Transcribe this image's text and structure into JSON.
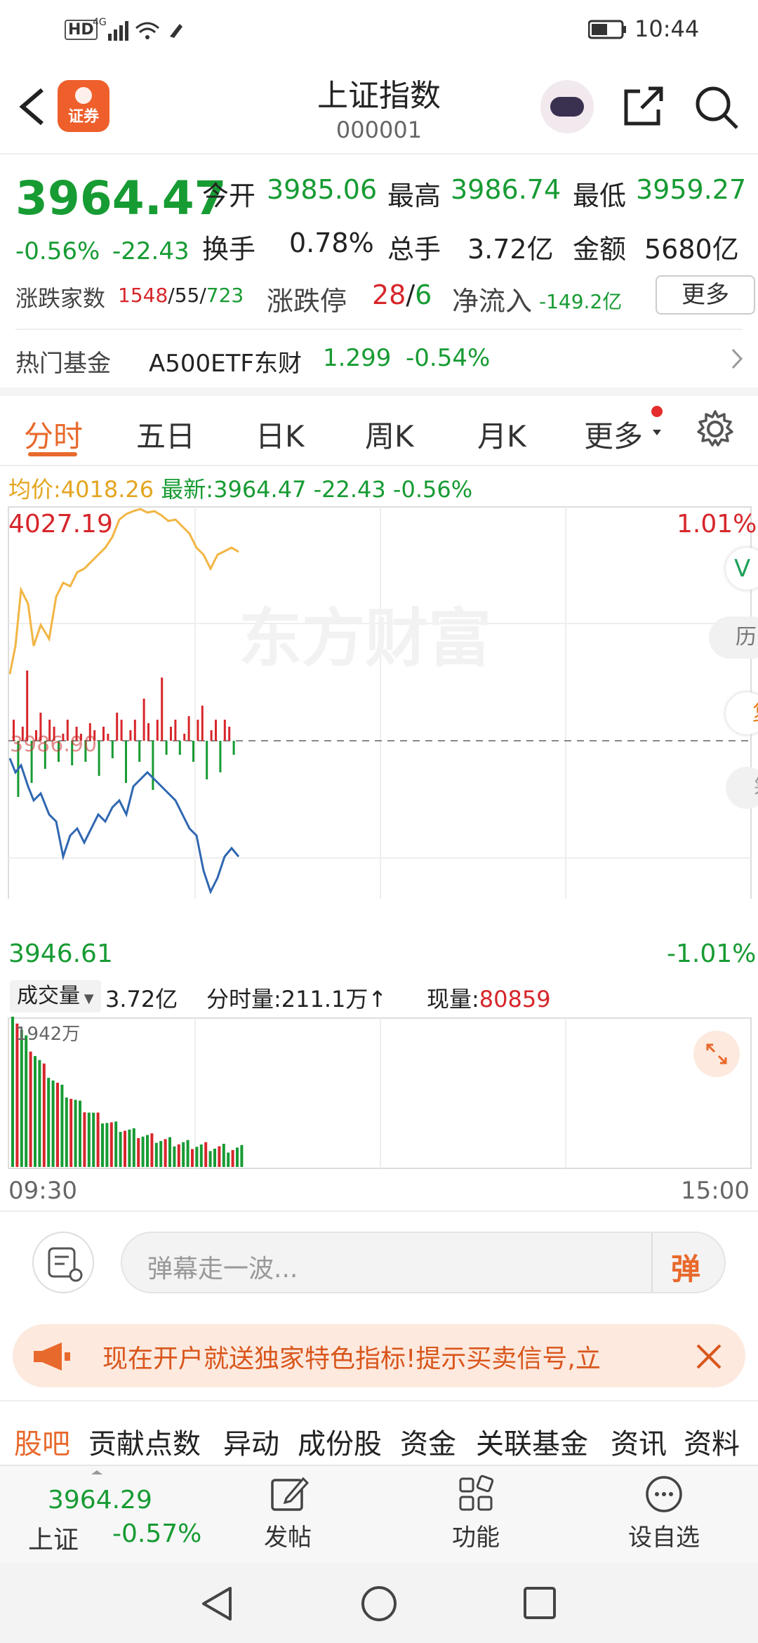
{
  "status": {
    "indicators": "HD 4G",
    "time": "10:44"
  },
  "header": {
    "app_badge": "证券",
    "title": "上证指数",
    "code": "000001"
  },
  "quote": {
    "price": "3964.47",
    "change_pct": "-0.56%",
    "change": "-22.43",
    "open_label": "今开",
    "open": "3985.06",
    "high_label": "最高",
    "high": "3986.74",
    "low_label": "最低",
    "low": "3959.27",
    "turnover_label": "换手",
    "turnover": "0.78%",
    "volume_label": "总手",
    "volume": "3.72亿",
    "amount_label": "金额",
    "amount": "5680亿",
    "breadth_label": "涨跌家数",
    "up": "1548",
    "flat": "55",
    "down": "723",
    "limit_label": "涨跌停",
    "limit_up": "28",
    "limit_down": "6",
    "netflow_label": "净流入",
    "netflow": "-149.2亿",
    "more": "更多"
  },
  "fund": {
    "label": "热门基金",
    "name": "A500ETF东财",
    "price": "1.299",
    "change": "-0.54%"
  },
  "tabs": [
    "分时",
    "五日",
    "日K",
    "周K",
    "月K",
    "更多"
  ],
  "chart": {
    "avg_label": "均价:",
    "avg": "4018.26",
    "last_label": "最新:",
    "last": "3964.47",
    "last_chg": "-22.43",
    "last_pct": "-0.56%",
    "y_top": "4027.19",
    "y_bottom": "3946.61",
    "pct_top": "1.01%",
    "pct_bottom": "-1.01%",
    "prev_close": "3986.90",
    "watermark": "东方财富",
    "side_buttons": [
      "V",
      "历",
      "复",
      "筹"
    ],
    "volume_selector": "成交量",
    "total_volume": "3.72亿",
    "minute_volume": "分时量:211.1万↑",
    "now_label": "现量:",
    "now_value": "80859",
    "vol_max": "1942万",
    "time_start": "09:30",
    "time_end": "15:00"
  },
  "comment": {
    "placeholder": "弹幕走一波...",
    "danmu_icon": "弹"
  },
  "banner": {
    "text": "现在开户就送独家特色指标!提示买卖信号,立"
  },
  "bottom_tabs": [
    "股吧",
    "贡献点数",
    "异动",
    "成份股",
    "资金",
    "关联基金",
    "资讯",
    "资料"
  ],
  "bottom_nav": {
    "index_value": "3964.29",
    "index_name": "上证",
    "index_pct": "-0.57%",
    "post": "发帖",
    "func": "功能",
    "watch": "设自选"
  },
  "colors": {
    "accent": "#e8692c",
    "up": "#d7262b",
    "down": "#179b33",
    "avg_line": "#f2b544",
    "price_line": "#2f67b1"
  }
}
